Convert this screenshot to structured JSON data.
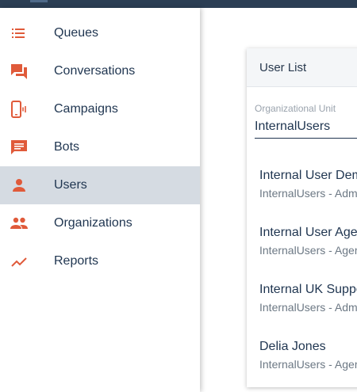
{
  "sidebar": {
    "items": [
      {
        "label": "Queues",
        "icon": "list-icon"
      },
      {
        "label": "Conversations",
        "icon": "chat-bubbles-icon"
      },
      {
        "label": "Campaigns",
        "icon": "phone-ringing-icon"
      },
      {
        "label": "Bots",
        "icon": "message-icon"
      },
      {
        "label": "Users",
        "icon": "person-icon",
        "active": true
      },
      {
        "label": "Organizations",
        "icon": "people-icon"
      },
      {
        "label": "Reports",
        "icon": "trending-up-icon"
      }
    ]
  },
  "panel": {
    "title": "User List",
    "ou_label": "Organizational Unit",
    "ou_value": "InternalUsers",
    "users": [
      {
        "name": "Internal User Dem",
        "sub": "InternalUsers - Adm"
      },
      {
        "name": "Internal User Age",
        "sub": "InternalUsers - Ager"
      },
      {
        "name": "Internal UK Suppo",
        "sub": "InternalUsers - Adm"
      },
      {
        "name": "Delia Jones",
        "sub": "InternalUsers - Ager"
      }
    ]
  },
  "colors": {
    "accent": "#e05a3a",
    "topbar": "#2b3e54",
    "active_bg": "#d5dbe2",
    "text": "#1f3550"
  }
}
